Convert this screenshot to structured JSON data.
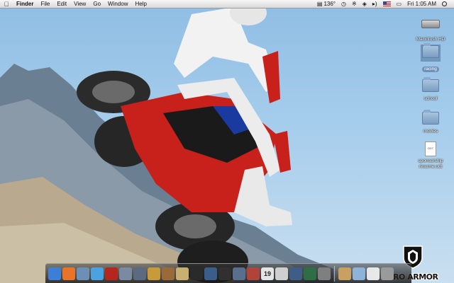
{
  "menubar": {
    "apple_icon": "apple-icon",
    "app_name": "Finder",
    "menus": [
      "File",
      "Edit",
      "View",
      "Go",
      "Window",
      "Help"
    ],
    "status": {
      "temperature": "136°",
      "clock": "Fri 1:05 AM"
    }
  },
  "desktop": {
    "icons": [
      {
        "label": "Macintosh HD",
        "kind": "hard-drive"
      },
      {
        "label": "racing",
        "kind": "folder",
        "selected": true
      },
      {
        "label": "school",
        "kind": "folder"
      },
      {
        "label": "movies",
        "kind": "folder"
      },
      {
        "label": "sponsorship resume.odt",
        "kind": "document",
        "ext": "ODT"
      }
    ]
  },
  "wallpaper": {
    "logo_text": "PRO ARMOR"
  },
  "dock": {
    "apps": [
      {
        "icon": "finder-icon",
        "color": "#3d7fd6"
      },
      {
        "icon": "firefox-icon",
        "color": "#e8742a"
      },
      {
        "icon": "preview-icon",
        "color": "#6c8fb5"
      },
      {
        "icon": "itunes-icon",
        "color": "#4aa3e0"
      },
      {
        "icon": "photo-booth-icon",
        "color": "#b4261e"
      },
      {
        "icon": "iphoto-icon",
        "color": "#7b8aa3"
      },
      {
        "icon": "imovie-icon",
        "color": "#5a6a80"
      },
      {
        "icon": "garageband-icon",
        "color": "#c79a3a"
      },
      {
        "icon": "iweb-icon",
        "color": "#9a6a3a"
      },
      {
        "icon": "guitar-icon",
        "color": "#c8b072"
      },
      {
        "icon": "front-row-icon",
        "color": "#2a2a2a"
      },
      {
        "icon": "quicktime-icon",
        "color": "#3b5d8a"
      },
      {
        "icon": "dashboard-icon",
        "color": "#303030"
      },
      {
        "icon": "expose-icon",
        "color": "#5a6f8e"
      },
      {
        "icon": "address-book-icon",
        "color": "#b0443a"
      },
      {
        "icon": "ical-icon",
        "color": "#e4e4e4",
        "text": "19"
      },
      {
        "icon": "mail-icon",
        "color": "#cfcfcf"
      },
      {
        "icon": "spaces-icon",
        "color": "#3e5e86"
      },
      {
        "icon": "time-machine-icon",
        "color": "#2e6e44"
      },
      {
        "icon": "system-preferences-icon",
        "color": "#7f7f7f"
      }
    ],
    "stacks": [
      {
        "icon": "applications-stack-icon",
        "color": "#c8a060"
      },
      {
        "icon": "documents-stack-icon",
        "color": "#8db4d8"
      },
      {
        "icon": "downloads-stack-icon",
        "color": "#e8e8e8"
      },
      {
        "icon": "trash-icon",
        "color": "#9a9a9a"
      }
    ]
  }
}
